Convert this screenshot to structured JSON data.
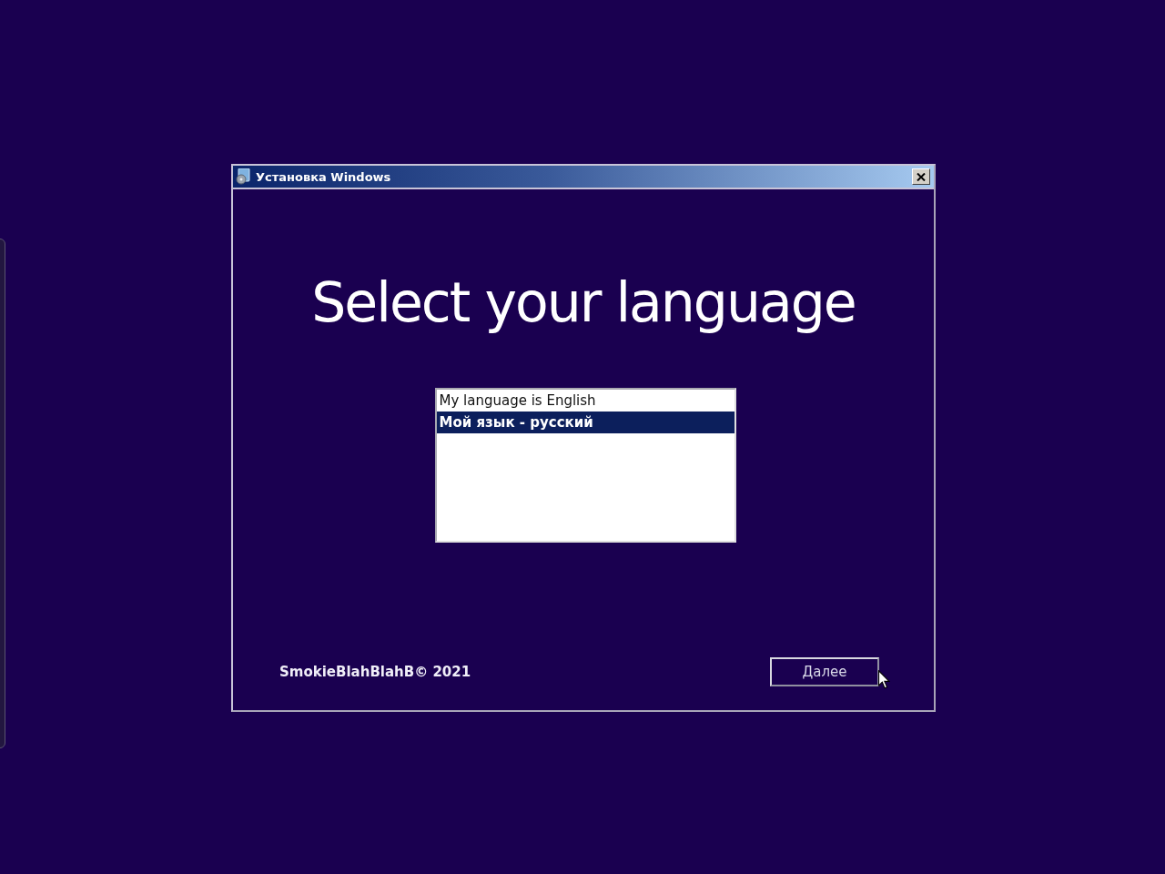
{
  "window": {
    "title": "Установка Windows"
  },
  "heading": "Select your language",
  "language_list": {
    "items": [
      {
        "label": "My language is English",
        "selected": false
      },
      {
        "label": "Мой язык - русский",
        "selected": true
      }
    ]
  },
  "footer": {
    "copyright": "SmokieBlahBlahB© 2021"
  },
  "buttons": [
    "Далее"
  ]
}
